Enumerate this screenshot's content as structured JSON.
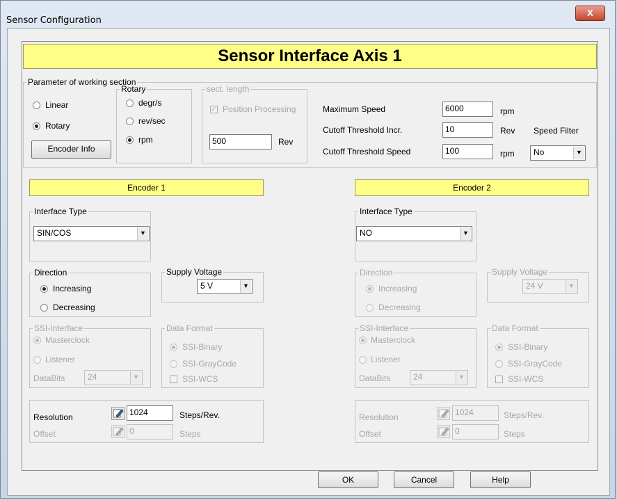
{
  "window": {
    "title": "Sensor Configuration",
    "close_label": "X"
  },
  "banner": {
    "title": "Sensor Interface Axis 1"
  },
  "working": {
    "legend": "Parameter of working section",
    "linear": "Linear",
    "rotary": "Rotary",
    "encoder_info": "Encoder Info",
    "rotary_group": {
      "legend": "Rotary",
      "degr": "degr/s",
      "rev": "rev/sec",
      "rpm": "rpm",
      "selected": "rpm"
    },
    "sect": {
      "legend": "sect. length",
      "position_processing": "Position Processing",
      "value": "500",
      "unit": "Rev"
    },
    "max_speed": {
      "label": "Maximum Speed",
      "value": "6000",
      "unit": "rpm"
    },
    "cutoff_incr": {
      "label": "Cutoff Threshold Incr.",
      "value": "10",
      "unit": "Rev"
    },
    "cutoff_speed": {
      "label": "Cutoff Threshold Speed",
      "value": "100",
      "unit": "rpm"
    },
    "speed_filter": {
      "label": "Speed Filter",
      "value": "No"
    },
    "mode_selected": "Rotary"
  },
  "encoder1": {
    "title": "Encoder 1",
    "interface_legend": "Interface Type",
    "interface_value": "SIN/COS",
    "direction_legend": "Direction",
    "increasing": "Increasing",
    "decreasing": "Decreasing",
    "supply_legend": "Supply Voltage",
    "supply_value": "5 V",
    "ssi_legend": "SSI-Interface",
    "masterclock": "Masterclock",
    "listener": "Listener",
    "databits_label": "DataBits",
    "databits_value": "24",
    "format_legend": "Data Format",
    "ssi_binary": "SSI-Binary",
    "ssi_gray": "SSI-GrayCode",
    "ssi_wcs": "SSI-WCS",
    "resolution_label": "Resolution",
    "resolution_value": "1024",
    "resolution_unit": "Steps/Rev.",
    "offset_label": "Offset",
    "offset_value": "0",
    "offset_unit": "Steps"
  },
  "encoder2": {
    "title": "Encoder 2",
    "interface_legend": "Interface Type",
    "interface_value": "NO",
    "direction_legend": "Direction",
    "increasing": "Increasing",
    "decreasing": "Decreasing",
    "supply_legend": "Supply Voltage",
    "supply_value": "24 V",
    "ssi_legend": "SSI-Interface",
    "masterclock": "Masterclock",
    "listener": "Listener",
    "databits_label": "DataBits",
    "databits_value": "24",
    "format_legend": "Data Format",
    "ssi_binary": "SSI-Binary",
    "ssi_gray": "SSI-GrayCode",
    "ssi_wcs": "SSI-WCS",
    "resolution_label": "Resolution",
    "resolution_value": "1024",
    "resolution_unit": "Steps/Rev.",
    "offset_label": "Offset",
    "offset_value": "0",
    "offset_unit": "Steps"
  },
  "footer": {
    "ok": "OK",
    "cancel": "Cancel",
    "help": "Help"
  },
  "colors": {
    "banner": "#ffff88",
    "close": "#c5442d",
    "disabled_text": "#a7a7a7"
  },
  "icons": {
    "edit": "edit-pencil-icon",
    "dropdown": "chevron-down-icon"
  }
}
